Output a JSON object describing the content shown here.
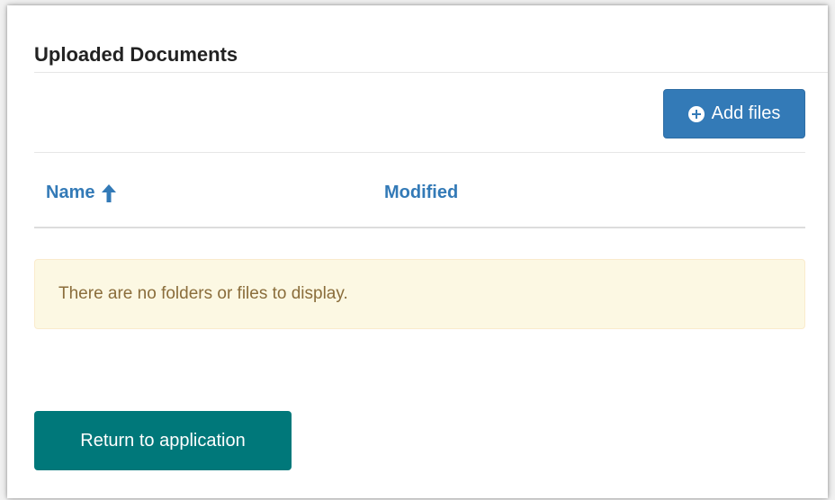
{
  "section": {
    "title": "Uploaded Documents"
  },
  "toolbar": {
    "add_files_label": "Add files",
    "add_files_icon": "plus-circle-icon"
  },
  "table": {
    "columns": [
      {
        "label": "Name",
        "sort_icon": "arrow-up-icon",
        "sorted": "ascending"
      },
      {
        "label": "Modified"
      }
    ],
    "empty_message": "There are no folders or files to display."
  },
  "actions": {
    "return_label": "Return to application"
  },
  "colors": {
    "primary_blue": "#337ab7",
    "teal_button": "#00787a",
    "alert_bg": "#fcf8e3",
    "alert_text": "#8a6d3b"
  }
}
